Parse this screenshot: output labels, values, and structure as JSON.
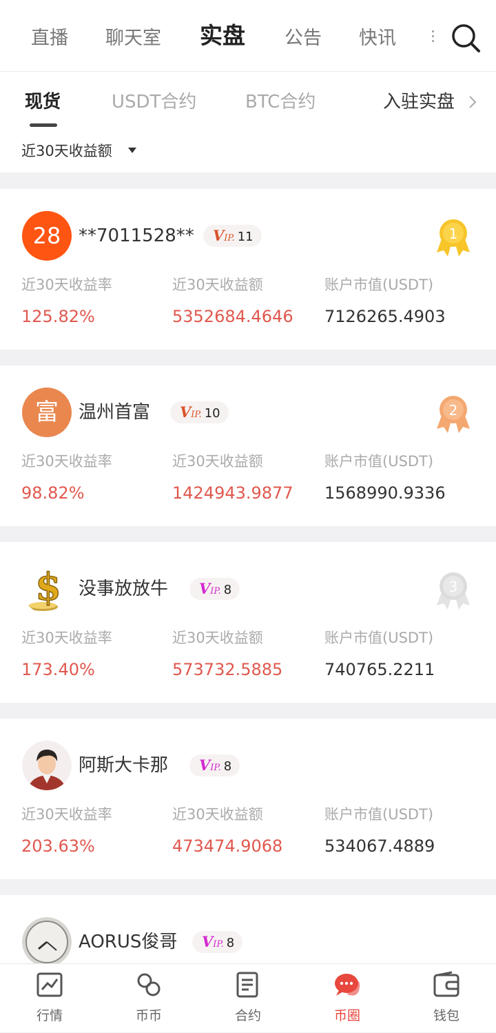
{
  "top_tabs": [
    "直播",
    "聊天室",
    "实盘",
    "公告",
    "快讯"
  ],
  "sub_tabs": [
    "现货",
    "USDT合约",
    "BTC合约"
  ],
  "join_label": "入驻实盘",
  "filter_label": "近30天收益额",
  "labels": {
    "rate": "近30天收益率",
    "amount": "近30天收益额",
    "market": "账户市值(USDT)"
  },
  "vip_prefix": "V",
  "vip_suffix": "IP.",
  "traders": [
    {
      "avatar_text": "28",
      "name": "**7011528**",
      "vip": "11",
      "rank": "1",
      "rate": "125.82%",
      "amount": "5352684.4646",
      "market": "7126265.4903"
    },
    {
      "avatar_text": "富",
      "name": "温州首富",
      "vip": "10",
      "rank": "2",
      "rate": "98.82%",
      "amount": "1424943.9877",
      "market": "1568990.9336"
    },
    {
      "name": "没事放放牛",
      "vip": "8",
      "rank": "3",
      "rate": "173.40%",
      "amount": "573732.5885",
      "market": "740765.2211"
    },
    {
      "name": "阿斯大卡那",
      "vip": "8",
      "rate": "203.63%",
      "amount": "473474.9068",
      "market": "534067.4889"
    },
    {
      "name": "AORUS俊哥",
      "vip": "8"
    }
  ],
  "bottom_tabs": [
    "行情",
    "币币",
    "合约",
    "币圈",
    "钱包"
  ],
  "colors": {
    "accent": "#e8473d",
    "profit": "#e0584e",
    "gold": "#f7c52a",
    "bronze": "#f4a770",
    "silver": "#dcdcdc"
  },
  "icons": [
    "search-icon",
    "chevron-right-icon",
    "caret-down-icon",
    "medal-icon",
    "chart-icon",
    "exchange-icon",
    "contract-icon",
    "chat-icon",
    "wallet-icon"
  ]
}
